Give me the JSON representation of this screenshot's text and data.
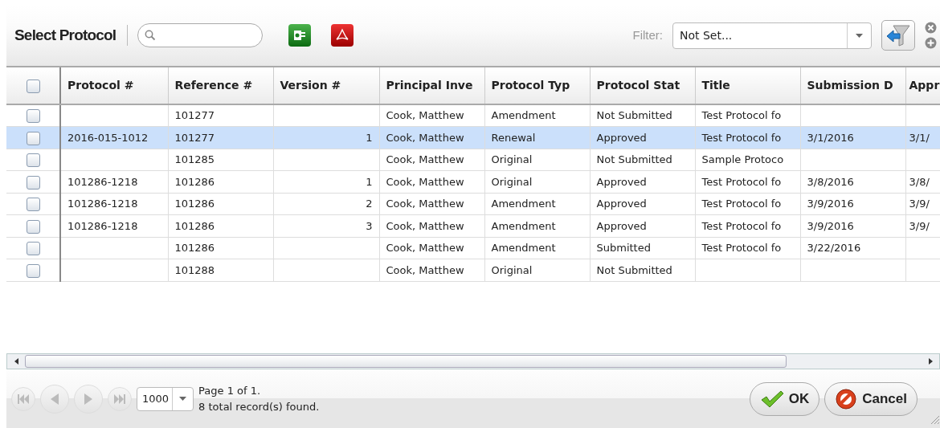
{
  "window": {
    "title": "Select Protocol"
  },
  "filter": {
    "label": "Filter:",
    "value": "Not Set..."
  },
  "table": {
    "select_all": {
      "checked": false
    },
    "columns": [
      "Protocol #",
      "Reference #",
      "Version #",
      "Principal Inve",
      "Protocol Typ",
      "Protocol Stat",
      "Title",
      "Submission D",
      "Appr"
    ],
    "rows": [
      {
        "selected": false,
        "checked": false,
        "cells": [
          null,
          "101277",
          null,
          "Cook, Matthew",
          "Amendment",
          "Not Submitted",
          "Test Protocol fo",
          null,
          null
        ]
      },
      {
        "selected": true,
        "checked": false,
        "cells": [
          "2016-015-1012",
          "101277",
          "1",
          "Cook, Matthew",
          "Renewal",
          "Approved",
          "Test Protocol fo",
          "3/1/2016",
          "3/1/"
        ]
      },
      {
        "selected": false,
        "checked": false,
        "cells": [
          null,
          "101285",
          null,
          "Cook, Matthew",
          "Original",
          "Not Submitted",
          "Sample Protoco",
          null,
          null
        ]
      },
      {
        "selected": false,
        "checked": false,
        "cells": [
          "101286-1218",
          "101286",
          "1",
          "Cook, Matthew",
          "Original",
          "Approved",
          "Test Protocol fo",
          "3/8/2016",
          "3/8/"
        ]
      },
      {
        "selected": false,
        "checked": false,
        "cells": [
          "101286-1218",
          "101286",
          "2",
          "Cook, Matthew",
          "Amendment",
          "Approved",
          "Test Protocol fo",
          "3/9/2016",
          "3/9/"
        ]
      },
      {
        "selected": false,
        "checked": false,
        "cells": [
          "101286-1218",
          "101286",
          "3",
          "Cook, Matthew",
          "Amendment",
          "Approved",
          "Test Protocol fo",
          "3/9/2016",
          "3/9/"
        ]
      },
      {
        "selected": false,
        "checked": false,
        "cells": [
          null,
          "101286",
          null,
          "Cook, Matthew",
          "Amendment",
          "Submitted",
          "Test Protocol fo",
          "3/22/2016",
          null
        ]
      },
      {
        "selected": false,
        "checked": false,
        "cells": [
          null,
          "101288",
          null,
          "Cook, Matthew",
          "Original",
          "Not Submitted",
          null,
          null,
          null
        ]
      }
    ]
  },
  "pager": {
    "page_size": "1000",
    "page_text": "Page 1 of 1.",
    "records_text": "8 total record(s) found."
  },
  "buttons": [
    {
      "label": "OK",
      "kind": "ok"
    },
    {
      "label": "Cancel",
      "kind": "cancel"
    }
  ]
}
